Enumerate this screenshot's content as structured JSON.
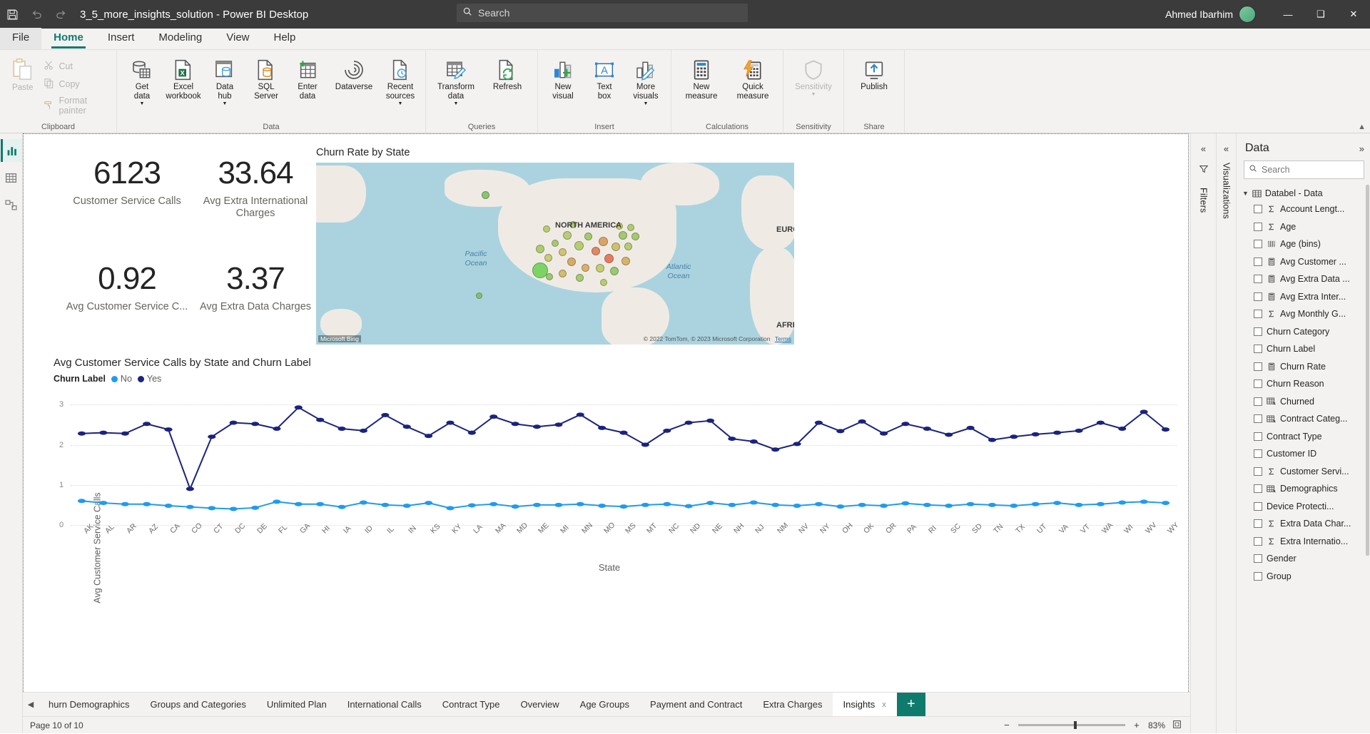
{
  "titlebar": {
    "save_icon": "save-icon",
    "undo_icon": "undo-icon",
    "redo_icon": "redo-icon",
    "document_title": "3_5_more_insights_solution - Power BI Desktop",
    "search_placeholder": "Search",
    "search_value": "",
    "user_name": "Ahmed Ibarhim",
    "minimize_label": "—",
    "maximize_label": "❑",
    "close_label": "✕"
  },
  "ribbon_tabs": [
    {
      "label": "File",
      "active": false
    },
    {
      "label": "Home",
      "active": true
    },
    {
      "label": "Insert",
      "active": false
    },
    {
      "label": "Modeling",
      "active": false
    },
    {
      "label": "View",
      "active": false
    },
    {
      "label": "Help",
      "active": false
    }
  ],
  "ribbon": {
    "clipboard": {
      "group_label": "Clipboard",
      "paste_label": "Paste",
      "cut_label": "Cut",
      "copy_label": "Copy",
      "format_painter_label": "Format painter"
    },
    "data": {
      "group_label": "Data",
      "items": [
        {
          "label": "Get\ndata",
          "icon": "get-data-icon",
          "caret": true
        },
        {
          "label": "Excel\nworkbook",
          "icon": "excel-workbook-icon",
          "caret": false
        },
        {
          "label": "Data\nhub",
          "icon": "data-hub-icon",
          "caret": true
        },
        {
          "label": "SQL\nServer",
          "icon": "sql-server-icon",
          "caret": false
        },
        {
          "label": "Enter\ndata",
          "icon": "enter-data-icon",
          "caret": false
        },
        {
          "label": "Dataverse",
          "icon": "dataverse-icon",
          "caret": false
        },
        {
          "label": "Recent\nsources",
          "icon": "recent-sources-icon",
          "caret": true
        }
      ]
    },
    "queries": {
      "group_label": "Queries",
      "items": [
        {
          "label": "Transform\ndata",
          "icon": "transform-data-icon",
          "caret": true
        },
        {
          "label": "Refresh",
          "icon": "refresh-icon",
          "caret": false
        }
      ]
    },
    "insert": {
      "group_label": "Insert",
      "items": [
        {
          "label": "New\nvisual",
          "icon": "new-visual-icon",
          "caret": false
        },
        {
          "label": "Text\nbox",
          "icon": "text-box-icon",
          "caret": false
        },
        {
          "label": "More\nvisuals",
          "icon": "more-visuals-icon",
          "caret": true
        }
      ]
    },
    "calculations": {
      "group_label": "Calculations",
      "items": [
        {
          "label": "New\nmeasure",
          "icon": "new-measure-icon",
          "caret": false
        },
        {
          "label": "Quick\nmeasure",
          "icon": "quick-measure-icon",
          "caret": false
        }
      ]
    },
    "sensitivity": {
      "group_label": "Sensitivity",
      "items": [
        {
          "label": "Sensitivity",
          "icon": "sensitivity-icon",
          "caret": true
        }
      ]
    },
    "share": {
      "group_label": "Share",
      "items": [
        {
          "label": "Publish",
          "icon": "publish-icon",
          "caret": false
        }
      ]
    },
    "collapse_icon": "chevron-up-icon"
  },
  "left_rail": [
    {
      "name": "report-view",
      "icon": "report-chart-icon",
      "active": true
    },
    {
      "name": "table-view",
      "icon": "table-grid-icon",
      "active": false
    },
    {
      "name": "model-view",
      "icon": "model-relationship-icon",
      "active": false
    }
  ],
  "report": {
    "kpis": [
      {
        "value": "6123",
        "caption": "Customer Service Calls"
      },
      {
        "value": "33.64",
        "caption": "Avg Extra International Charges"
      },
      {
        "value": "0.92",
        "caption": "Avg Customer Service C..."
      },
      {
        "value": "3.37",
        "caption": "Avg Extra Data Charges"
      }
    ],
    "map": {
      "title": "Churn Rate by State",
      "labels": [
        {
          "text": "NORTH AMERICA",
          "style": "dark"
        },
        {
          "text": "EUROPE",
          "style": "dark"
        },
        {
          "text": "AFRICA",
          "style": "dark"
        },
        {
          "text": "Pacific Ocean",
          "style": "ocean"
        },
        {
          "text": "Atlantic Ocean",
          "style": "ocean"
        }
      ],
      "bing_credit": "Microsoft Bing",
      "attribution": "© 2022 TomTom, © 2023 Microsoft Corporation",
      "terms_label": "Terms"
    }
  },
  "chart_data": {
    "type": "line",
    "title": "Avg Customer Service Calls by State and Churn Label",
    "xlabel": "State",
    "ylabel": "Avg Customer Service Calls",
    "legend_title": "Churn Label",
    "legend_position": "top-left",
    "grid": true,
    "ylim": [
      0,
      3.2
    ],
    "yticks": [
      0,
      1,
      2,
      3
    ],
    "categories": [
      "AK",
      "AL",
      "AR",
      "AZ",
      "CA",
      "CO",
      "CT",
      "DC",
      "DE",
      "FL",
      "GA",
      "HI",
      "IA",
      "ID",
      "IL",
      "IN",
      "KS",
      "KY",
      "LA",
      "MA",
      "MD",
      "ME",
      "MI",
      "MN",
      "MO",
      "MS",
      "MT",
      "NC",
      "ND",
      "NE",
      "NH",
      "NJ",
      "NM",
      "NV",
      "NY",
      "OH",
      "OK",
      "OR",
      "PA",
      "RI",
      "SC",
      "SD",
      "TN",
      "TX",
      "UT",
      "VA",
      "VT",
      "WA",
      "WI",
      "WV",
      "WY"
    ],
    "series": [
      {
        "name": "No",
        "color": "#1f9bf0",
        "values": [
          0.6,
          0.55,
          0.52,
          0.52,
          0.48,
          0.45,
          0.42,
          0.4,
          0.43,
          0.58,
          0.52,
          0.52,
          0.45,
          0.56,
          0.5,
          0.48,
          0.55,
          0.42,
          0.49,
          0.52,
          0.46,
          0.5,
          0.5,
          0.52,
          0.48,
          0.46,
          0.5,
          0.52,
          0.47,
          0.55,
          0.5,
          0.56,
          0.5,
          0.48,
          0.52,
          0.46,
          0.5,
          0.48,
          0.54,
          0.5,
          0.48,
          0.52,
          0.5,
          0.48,
          0.52,
          0.55,
          0.5,
          0.52,
          0.56,
          0.58,
          0.55
        ]
      },
      {
        "name": "Yes",
        "color": "#1a237e",
        "values": [
          2.28,
          2.3,
          2.28,
          2.52,
          2.38,
          0.9,
          2.2,
          2.55,
          2.52,
          2.4,
          2.93,
          2.62,
          2.4,
          2.35,
          2.74,
          2.45,
          2.22,
          2.55,
          2.3,
          2.7,
          2.52,
          2.45,
          2.5,
          2.75,
          2.42,
          2.3,
          2.0,
          2.35,
          2.55,
          2.6,
          2.15,
          2.08,
          1.88,
          2.02,
          2.55,
          2.34,
          2.58,
          2.28,
          2.52,
          2.4,
          2.25,
          2.42,
          2.12,
          2.2,
          2.26,
          2.3,
          2.35,
          2.55,
          2.4,
          2.82,
          2.38
        ]
      }
    ]
  },
  "page_tabs": {
    "prev_arrow": "chevron-left-icon",
    "tabs": [
      {
        "label": "hurn Demographics",
        "active": false
      },
      {
        "label": "Groups and Categories",
        "active": false
      },
      {
        "label": "Unlimited Plan",
        "active": false
      },
      {
        "label": "International Calls",
        "active": false
      },
      {
        "label": "Contract Type",
        "active": false
      },
      {
        "label": "Overview",
        "active": false
      },
      {
        "label": "Age Groups",
        "active": false
      },
      {
        "label": "Payment and Contract",
        "active": false
      },
      {
        "label": "Extra Charges",
        "active": false
      },
      {
        "label": "Insights",
        "active": true
      }
    ],
    "close_label": "x",
    "add_page_label": "+"
  },
  "statusbar": {
    "page_info": "Page 10 of 10",
    "zoom_out": "−",
    "zoom_in": "+",
    "zoom_level": "83%",
    "fit_icon": "fit-to-page-icon"
  },
  "filters_pane": {
    "collapse_icon": "chevron-double-left-icon",
    "filter_icon": "filter-funnel-icon",
    "label": "Filters"
  },
  "visualizations_pane": {
    "collapse_icon": "chevron-double-left-icon",
    "label": "Visualizations"
  },
  "data_pane": {
    "title": "Data",
    "expand_icon": "chevron-double-right-icon",
    "search_placeholder": "Search",
    "search_value": "",
    "table_name": "Databel - Data",
    "table_icon": "table-icon",
    "expand_chevron": "chevron-down-icon",
    "fields": [
      {
        "label": "Account Lengt...",
        "icon": "sigma",
        "checked": false
      },
      {
        "label": "Age",
        "icon": "sigma",
        "checked": false
      },
      {
        "label": "Age (bins)",
        "icon": "bins",
        "checked": false
      },
      {
        "label": "Avg Customer ...",
        "icon": "measure",
        "checked": false
      },
      {
        "label": "Avg Extra Data ...",
        "icon": "measure",
        "checked": false
      },
      {
        "label": "Avg Extra Inter...",
        "icon": "measure",
        "checked": false
      },
      {
        "label": "Avg Monthly G...",
        "icon": "sigma",
        "checked": false
      },
      {
        "label": "Churn Category",
        "icon": "none",
        "checked": false
      },
      {
        "label": "Churn Label",
        "icon": "none",
        "checked": false
      },
      {
        "label": "Churn Rate",
        "icon": "measure",
        "checked": false
      },
      {
        "label": "Churn Reason",
        "icon": "none",
        "checked": false
      },
      {
        "label": "Churned",
        "icon": "grouped",
        "checked": false
      },
      {
        "label": "Contract Categ...",
        "icon": "grouped",
        "checked": false
      },
      {
        "label": "Contract Type",
        "icon": "none",
        "checked": false
      },
      {
        "label": "Customer ID",
        "icon": "none",
        "checked": false
      },
      {
        "label": "Customer Servi...",
        "icon": "sigma",
        "checked": false
      },
      {
        "label": "Demographics",
        "icon": "grouped",
        "checked": false
      },
      {
        "label": "Device Protecti...",
        "icon": "none",
        "checked": false
      },
      {
        "label": "Extra Data Char...",
        "icon": "sigma",
        "checked": false
      },
      {
        "label": "Extra Internatio...",
        "icon": "sigma",
        "checked": false
      },
      {
        "label": "Gender",
        "icon": "none",
        "checked": false
      },
      {
        "label": "Group",
        "icon": "none",
        "checked": false
      }
    ]
  }
}
